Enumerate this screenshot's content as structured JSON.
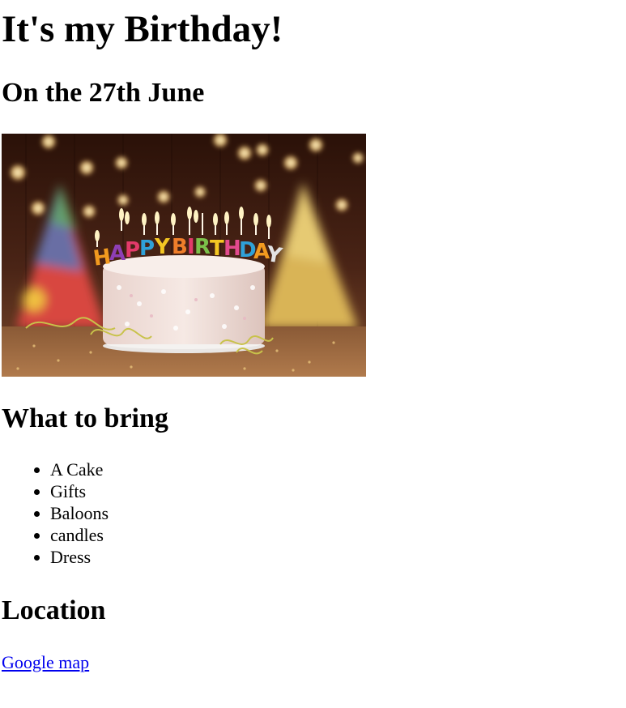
{
  "page": {
    "title": "It's my Birthday!",
    "date_heading": "On the 27th June"
  },
  "image": {
    "subject": "birthday-cake-with-candles",
    "candle_text": "HAPPY BIRTHDAY",
    "colors": {
      "background": "#3a1a10",
      "cake": "#f1e2dc",
      "plate": "#e9e6e4",
      "party_hat_left": "#d8473f",
      "party_hat_right": "#d9b457"
    }
  },
  "bring": {
    "heading": "What to bring",
    "items": [
      {
        "label": "A Cake"
      },
      {
        "label": "Gifts"
      },
      {
        "label": "Baloons"
      },
      {
        "label": "candles"
      },
      {
        "label": "Dress"
      }
    ]
  },
  "location": {
    "heading": "Location",
    "link_text": "Google map",
    "link_color": "#0000ee"
  }
}
